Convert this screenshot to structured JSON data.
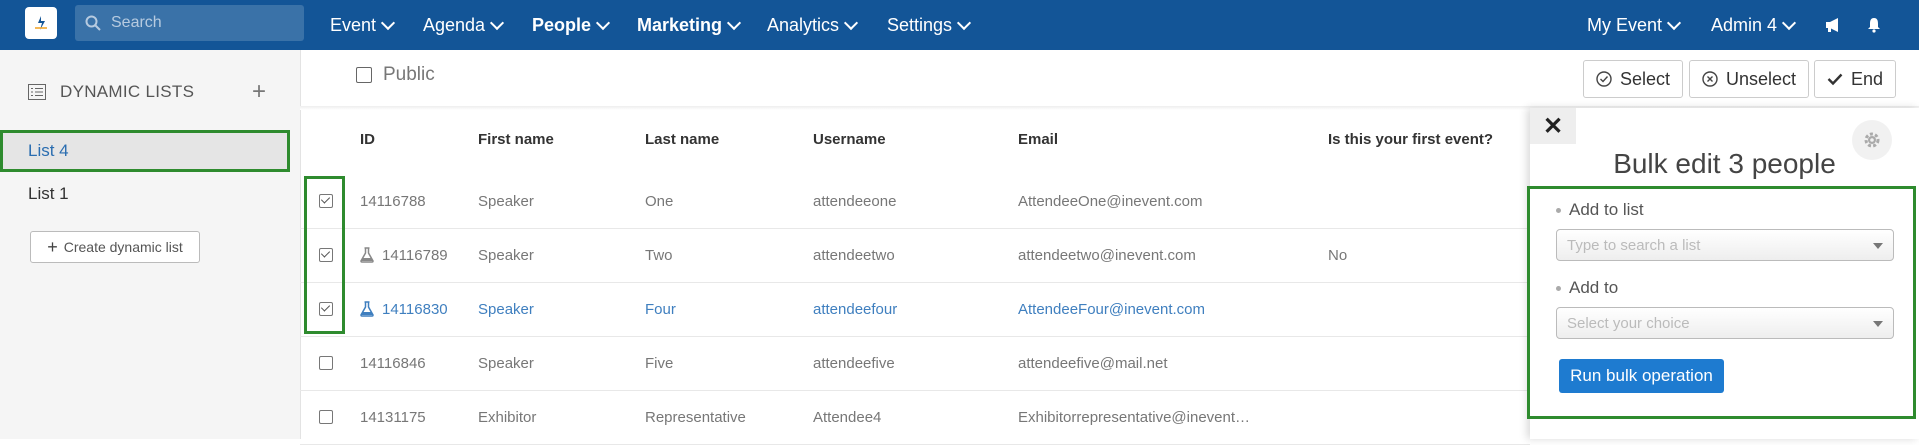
{
  "topbar": {
    "search_placeholder": "Search",
    "nav": [
      "Event",
      "Agenda",
      "People",
      "Marketing",
      "Analytics",
      "Settings"
    ],
    "my_event": "My Event",
    "admin": "Admin 4"
  },
  "sidebar": {
    "title": "DYNAMIC LISTS",
    "lists": [
      "List 4",
      "List 1"
    ],
    "create_label": "Create dynamic list"
  },
  "toolbar": {
    "public_label": "Public",
    "select_label": "Select",
    "unselect_label": "Unselect",
    "end_label": "End"
  },
  "table": {
    "columns": [
      "ID",
      "First name",
      "Last name",
      "Username",
      "Email",
      "Is this your first event?"
    ],
    "rows": [
      {
        "checked": true,
        "id": "14116788",
        "first": "Speaker",
        "last": "One",
        "username": "attendeeone",
        "email": "AttendeeOne@inevent.com",
        "first_event": "",
        "icon": "",
        "highlight": false
      },
      {
        "checked": true,
        "id": "14116789",
        "first": "Speaker",
        "last": "Two",
        "username": "attendeetwo",
        "email": "attendeetwo@inevent.com",
        "first_event": "No",
        "icon": "flask-icon",
        "highlight": false
      },
      {
        "checked": true,
        "id": "14116830",
        "first": "Speaker",
        "last": "Four",
        "username": "attendeefour",
        "email": "AttendeeFour@inevent.com",
        "first_event": "",
        "icon": "flask-icon",
        "highlight": true
      },
      {
        "checked": false,
        "id": "14116846",
        "first": "Speaker",
        "last": "Five",
        "username": "attendeefive",
        "email": "attendeefive@mail.net",
        "first_event": "",
        "icon": "",
        "highlight": false
      },
      {
        "checked": false,
        "id": "14131175",
        "first": "Exhibitor",
        "last": "Representative",
        "username": "Attendee4",
        "email": "Exhibitorrepresentative@inevent…",
        "first_event": "",
        "icon": "",
        "highlight": false
      }
    ]
  },
  "panel": {
    "title": "Bulk edit 3 people",
    "add_to_list_label": "Add to list",
    "add_to_list_placeholder": "Type to search a list",
    "add_to_label": "Add to",
    "add_to_placeholder": "Select your choice",
    "run_label": "Run bulk operation"
  },
  "colors": {
    "topbar": "#135597",
    "highlight_green": "#2e8b2e",
    "link_blue": "#3f7fbf",
    "run_button": "#1e7bd0"
  }
}
